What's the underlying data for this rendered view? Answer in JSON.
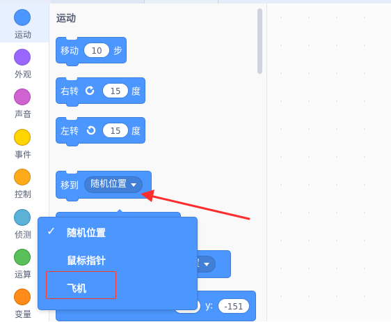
{
  "categories": [
    {
      "label": "运动",
      "color": "#4c97ff",
      "active": true
    },
    {
      "label": "外观",
      "color": "#9966ff"
    },
    {
      "label": "声音",
      "color": "#cf63cf"
    },
    {
      "label": "事件",
      "color": "#ffd500"
    },
    {
      "label": "控制",
      "color": "#ffab19"
    },
    {
      "label": "侦测",
      "color": "#5cb1d6"
    },
    {
      "label": "运算",
      "color": "#59c059"
    },
    {
      "label": "变量",
      "color": "#ff8c1a"
    }
  ],
  "palette": {
    "section_title": "运动",
    "blocks": {
      "move": {
        "prefix": "移动",
        "value": "10",
        "suffix": "步"
      },
      "turn_right": {
        "prefix": "右转",
        "icon": "rotate-right-icon",
        "value": "15",
        "suffix": "度"
      },
      "turn_left": {
        "prefix": "左转",
        "icon": "rotate-left-icon",
        "value": "15",
        "suffix": "度"
      },
      "goto": {
        "prefix": "移到",
        "dropdown": "随机位置"
      },
      "glide_partial": {
        "dropdown_tail": "置"
      },
      "goto_xy_partial": {
        "y_label": "y:",
        "y_value": "-151"
      }
    }
  },
  "dropdown_menu": {
    "items": [
      {
        "label": "随机位置",
        "checked": true
      },
      {
        "label": "鼠标指针",
        "checked": false
      },
      {
        "label": "飞机",
        "checked": false
      }
    ],
    "check_glyph": "✓"
  },
  "colors": {
    "motion": "#4c97ff",
    "annotation": "#ff3b30"
  }
}
